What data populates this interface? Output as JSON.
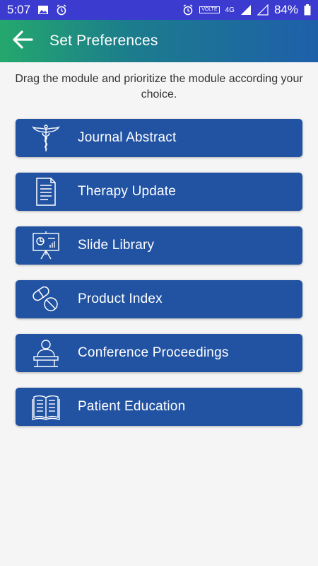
{
  "status_bar": {
    "time": "5:07",
    "network_label": "VOLTE",
    "network_type": "4G",
    "battery": "84%",
    "icons": [
      "image-icon",
      "alarm-icon",
      "alarm-icon",
      "volte-icon",
      "signal-icon",
      "signal-empty-icon",
      "battery-icon"
    ]
  },
  "app_bar": {
    "title": "Set Preferences",
    "back_icon": "arrow-left-icon",
    "gradient_colors": [
      "#24a86d",
      "#1e5faa"
    ]
  },
  "instructions": "Drag the module and prioritize the module according your choice.",
  "modules": [
    {
      "label": "Journal Abstract",
      "icon": "caduceus-icon"
    },
    {
      "label": "Therapy Update",
      "icon": "document-icon"
    },
    {
      "label": "Slide Library",
      "icon": "presentation-icon"
    },
    {
      "label": "Product Index",
      "icon": "pills-icon"
    },
    {
      "label": "Conference Proceedings",
      "icon": "speaker-podium-icon"
    },
    {
      "label": "Patient Education",
      "icon": "open-book-icon"
    }
  ],
  "colors": {
    "status_bar": "#3b3bd0",
    "module_bg": "#2253a3",
    "page_bg": "#f5f5f5"
  }
}
